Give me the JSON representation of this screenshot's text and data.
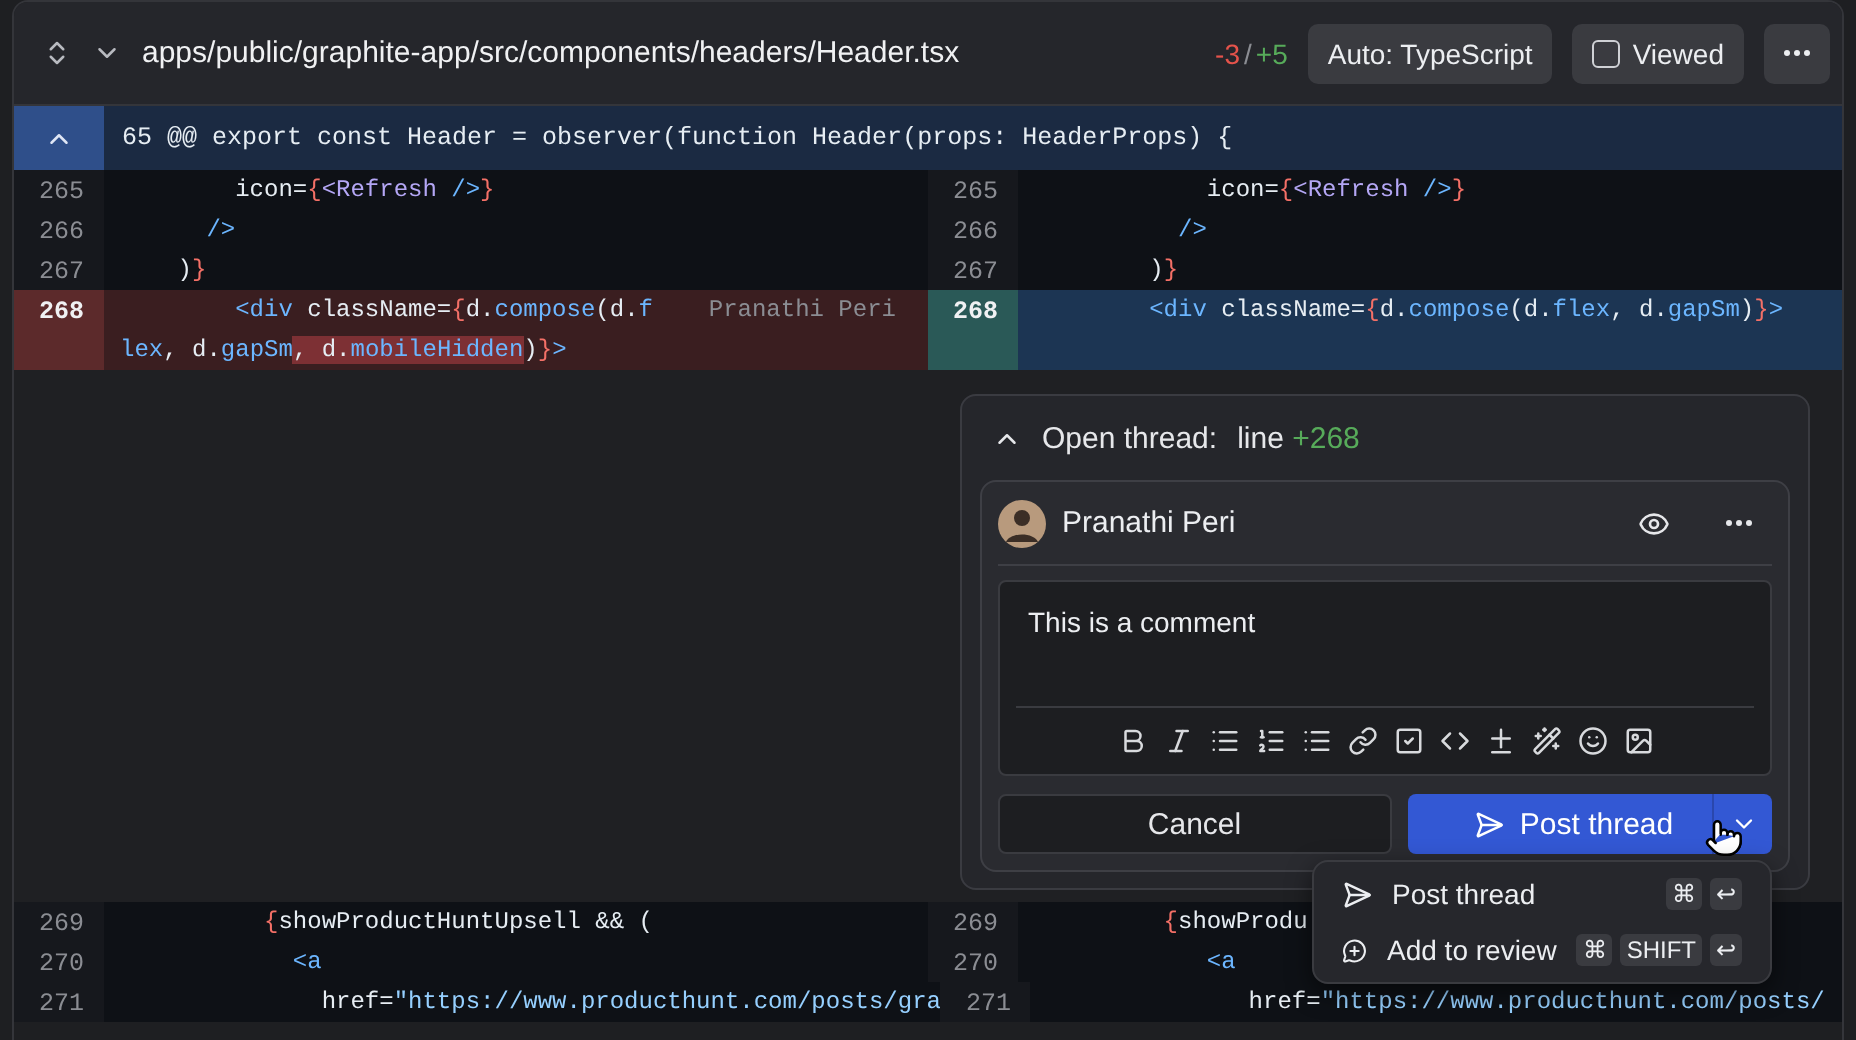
{
  "file_header": {
    "path": "apps/public/graphite-app/src/components/headers/Header.tsx",
    "deletions": "-3",
    "separator": "/",
    "additions": "+5",
    "language_button": "Auto: TypeScript",
    "viewed": {
      "label": "Viewed",
      "checked": false
    },
    "expanded": true
  },
  "hunk_header": {
    "text": "65 @@ export const Header = observer(function Header(props: HeaderProps) {",
    "expanded": true
  },
  "rows": [
    {
      "kind": "lines",
      "left": {
        "number": "265",
        "kind": "context",
        "lines": [
          [
            {
              "kind": "text",
              "text": "        icon="
            },
            {
              "kind": "brace",
              "text": "{"
            },
            {
              "kind": "component",
              "text": "<Refresh"
            },
            {
              "kind": "tag",
              "text": " />"
            },
            {
              "kind": "brace",
              "text": "}"
            }
          ]
        ]
      },
      "right": {
        "number": "265",
        "kind": "context",
        "lines": [
          [
            {
              "kind": "text",
              "text": "            icon="
            },
            {
              "kind": "brace",
              "text": "{"
            },
            {
              "kind": "component",
              "text": "<Refresh"
            },
            {
              "kind": "tag",
              "text": " />"
            },
            {
              "kind": "brace",
              "text": "}"
            }
          ]
        ]
      }
    },
    {
      "kind": "lines",
      "left": {
        "number": "266",
        "kind": "context",
        "lines": [
          [
            {
              "kind": "tag",
              "text": "      />"
            }
          ]
        ]
      },
      "right": {
        "number": "266",
        "kind": "context",
        "lines": [
          [
            {
              "kind": "tag",
              "text": "          />"
            }
          ]
        ]
      }
    },
    {
      "kind": "lines",
      "left": {
        "number": "267",
        "kind": "context",
        "lines": [
          [
            {
              "kind": "text",
              "text": "    )"
            },
            {
              "kind": "brace",
              "text": "}"
            }
          ]
        ]
      },
      "right": {
        "number": "267",
        "kind": "context",
        "lines": [
          [
            {
              "kind": "text",
              "text": "        )"
            },
            {
              "kind": "brace",
              "text": "}"
            }
          ]
        ]
      }
    },
    {
      "kind": "lines",
      "left": {
        "number": "268",
        "kind": "removed",
        "blame": "Pranathi Peri",
        "lines": [
          [
            {
              "kind": "tag",
              "text": "        <div"
            },
            {
              "kind": "text",
              "text": " className="
            },
            {
              "kind": "brace",
              "text": "{"
            },
            {
              "kind": "text",
              "text": "d."
            },
            {
              "kind": "member",
              "text": "compose"
            },
            {
              "kind": "text",
              "text": "(d."
            },
            {
              "kind": "member",
              "text": "f"
            }
          ],
          [
            {
              "kind": "member",
              "text": "lex"
            },
            {
              "kind": "text",
              "text": ", d."
            },
            {
              "kind": "member",
              "text": "gapSm"
            },
            {
              "kind": "text-changed",
              "text": ", d."
            },
            {
              "kind": "member-changed",
              "text": "mobileHidden"
            },
            {
              "kind": "text",
              "text": ")"
            },
            {
              "kind": "brace",
              "text": "}"
            },
            {
              "kind": "tag",
              "text": ">"
            }
          ]
        ]
      },
      "right": {
        "number": "268",
        "kind": "added",
        "lines": [
          [
            {
              "kind": "tag",
              "text": "        <div"
            },
            {
              "kind": "text",
              "text": " className="
            },
            {
              "kind": "brace",
              "text": "{"
            },
            {
              "kind": "text",
              "text": "d."
            },
            {
              "kind": "member",
              "text": "compose"
            },
            {
              "kind": "text",
              "text": "(d."
            },
            {
              "kind": "member",
              "text": "flex"
            },
            {
              "kind": "text",
              "text": ", d."
            },
            {
              "kind": "member",
              "text": "gapSm"
            },
            {
              "kind": "text",
              "text": ")"
            },
            {
              "kind": "brace",
              "text": "}"
            },
            {
              "kind": "tag",
              "text": ">"
            }
          ]
        ]
      }
    },
    {
      "kind": "thread",
      "title": "Open thread:",
      "line_label": "line",
      "line_number": "+268",
      "expanded": true,
      "author": "Pranathi Peri",
      "comment": "This is a comment",
      "cancel": "Cancel",
      "submit": "Post thread",
      "menu": [
        {
          "kind": "send",
          "label": "Post thread",
          "keys": [
            "⌘",
            "↩"
          ]
        },
        {
          "kind": "review",
          "label": "Add to review",
          "keys": [
            "⌘",
            "SHIFT",
            "↩"
          ]
        }
      ]
    },
    {
      "kind": "lines",
      "left": {
        "number": "269",
        "kind": "context",
        "lines": [
          [
            {
              "kind": "brace",
              "text": "          {"
            },
            {
              "kind": "text",
              "text": "showProductHuntUpsell && ("
            }
          ]
        ]
      },
      "right": {
        "number": "269",
        "kind": "context",
        "lines": [
          [
            {
              "kind": "brace",
              "text": "         {"
            },
            {
              "kind": "text",
              "text": "showProdu"
            }
          ]
        ]
      }
    },
    {
      "kind": "lines",
      "left": {
        "number": "270",
        "kind": "context",
        "lines": [
          [
            {
              "kind": "tag",
              "text": "            <a"
            }
          ]
        ]
      },
      "right": {
        "number": "270",
        "kind": "context",
        "lines": [
          [
            {
              "kind": "tag",
              "text": "            <a"
            }
          ]
        ]
      }
    },
    {
      "kind": "lines",
      "left": {
        "number": "271",
        "kind": "context",
        "lines": [
          [
            {
              "kind": "text",
              "text": "              href="
            },
            {
              "kind": "string",
              "text": "\"https://www.producthunt.com/posts/gra"
            }
          ]
        ]
      },
      "right": {
        "number": "271",
        "kind": "context",
        "lines": [
          [
            {
              "kind": "text",
              "text": "              href="
            },
            {
              "kind": "string",
              "text": "\"https://www.producthunt.com/posts/"
            }
          ]
        ]
      }
    }
  ]
}
